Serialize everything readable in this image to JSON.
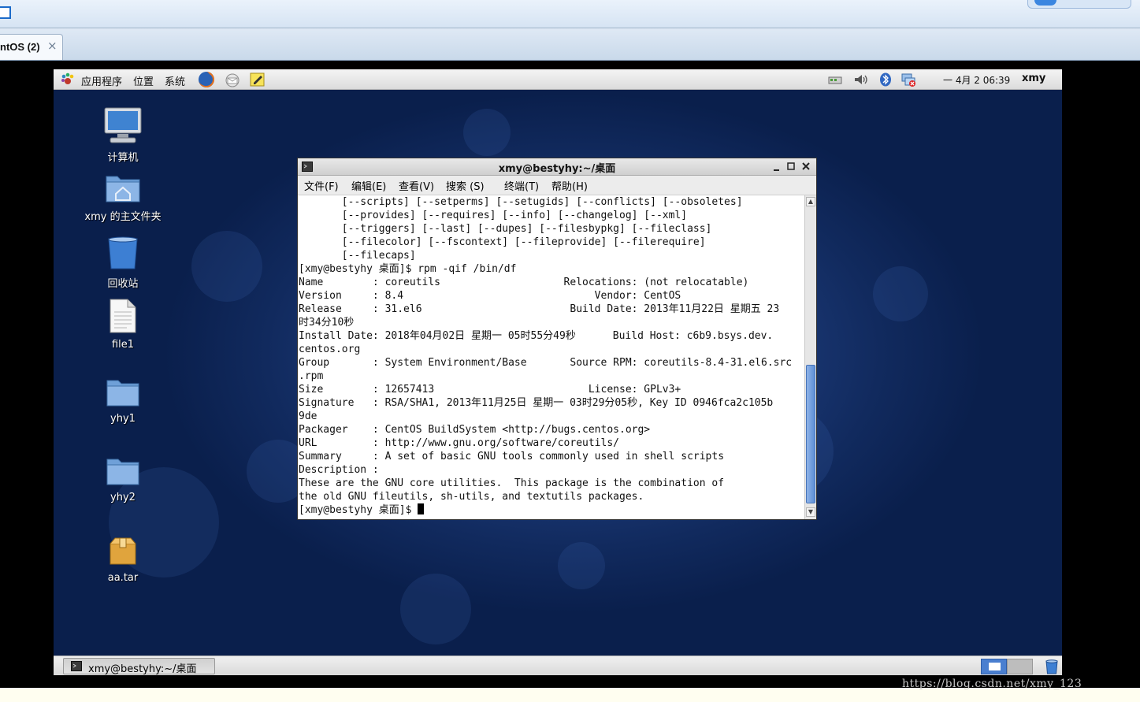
{
  "host": {
    "tab_label": "ntOS (2)",
    "tab_close": "×",
    "watermark": "https://blog.csdn.net/xmy_123"
  },
  "top_panel": {
    "applications": "应用程序",
    "places": "位置",
    "system": "系统",
    "clock": "一 4月  2 06:39",
    "user": "xmy"
  },
  "desktop": {
    "icons": [
      {
        "label": "计算机"
      },
      {
        "label": "xmy 的主文件夹"
      },
      {
        "label": "回收站"
      },
      {
        "label": "file1"
      },
      {
        "label": "yhy1"
      },
      {
        "label": "yhy2"
      },
      {
        "label": "aa.tar"
      }
    ]
  },
  "terminal": {
    "title": "xmy@bestyhy:~/桌面",
    "menu": [
      "文件(F)",
      "编辑(E)",
      "查看(V)",
      "搜索 (S)",
      "终端(T)",
      "帮助(H)"
    ],
    "lines": [
      "       [--scripts] [--setperms] [--setugids] [--conflicts] [--obsoletes]",
      "       [--provides] [--requires] [--info] [--changelog] [--xml]",
      "       [--triggers] [--last] [--dupes] [--filesbypkg] [--fileclass]",
      "       [--filecolor] [--fscontext] [--fileprovide] [--filerequire]",
      "       [--filecaps]",
      "[xmy@bestyhy 桌面]$ rpm -qif /bin/df",
      "Name        : coreutils                    Relocations: (not relocatable)",
      "Version     : 8.4                               Vendor: CentOS",
      "Release     : 31.el6                        Build Date: 2013年11月22日 星期五 23",
      "时34分10秒",
      "Install Date: 2018年04月02日 星期一 05时55分49秒      Build Host: c6b9.bsys.dev.",
      "centos.org",
      "Group       : System Environment/Base       Source RPM: coreutils-8.4-31.el6.src",
      ".rpm",
      "Size        : 12657413                         License: GPLv3+",
      "Signature   : RSA/SHA1, 2013年11月25日 星期一 03时29分05秒, Key ID 0946fca2c105b",
      "9de",
      "Packager    : CentOS BuildSystem <http://bugs.centos.org>",
      "URL         : http://www.gnu.org/software/coreutils/",
      "Summary     : A set of basic GNU tools commonly used in shell scripts",
      "Description :",
      "These are the GNU core utilities.  This package is the combination of",
      "the old GNU fileutils, sh-utils, and textutils packages."
    ],
    "prompt": "[xmy@bestyhy 桌面]$ "
  },
  "bottom_panel": {
    "taskbar_item": "xmy@bestyhy:~/桌面"
  }
}
